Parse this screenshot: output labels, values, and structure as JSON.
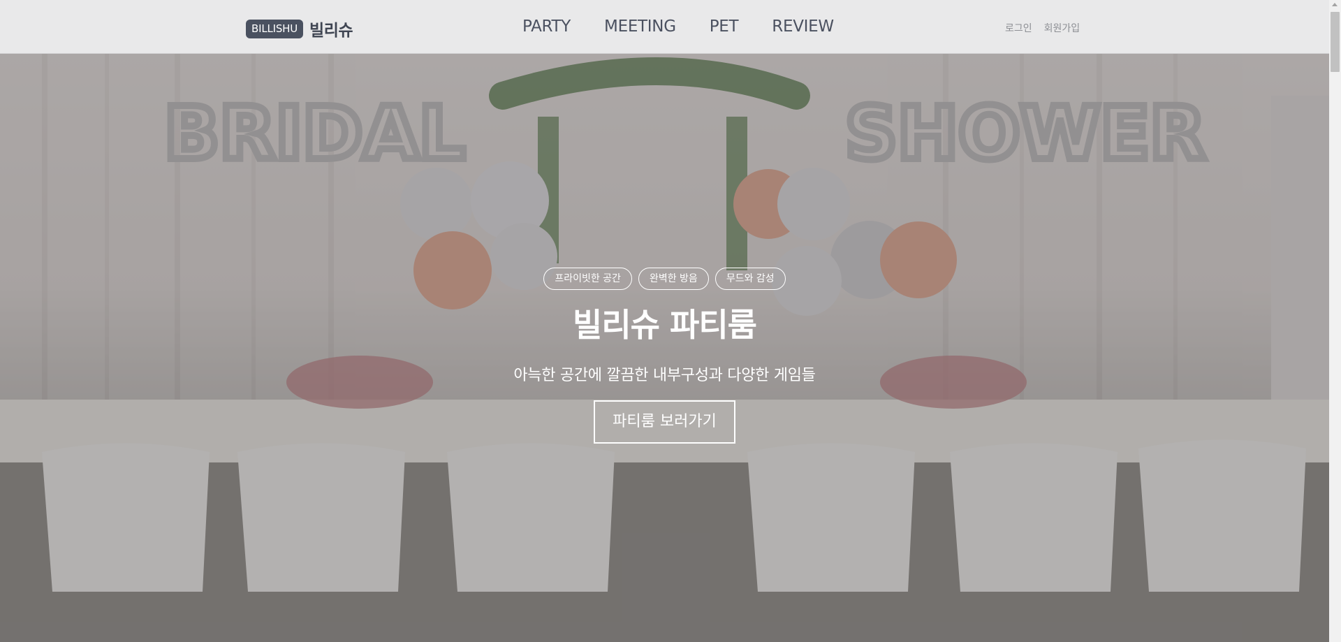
{
  "header": {
    "logo_badge": "BILLISHU",
    "logo_text": "빌리슈",
    "nav": [
      "PARTY",
      "MEETING",
      "PET",
      "REVIEW"
    ],
    "auth": {
      "login": "로그인",
      "signup": "회원가입"
    }
  },
  "hero": {
    "tags": [
      "프라이빗한 공간",
      "완벽한 방음",
      "무드와 감성"
    ],
    "title": "빌리슈 파티룸",
    "subtitle": "아늑한 공간에 깔끔한 내부구성과 다양한 게임들",
    "button": "파티룸 보러가기",
    "background_image": "bridal-shower-party-room-photo"
  },
  "colors": {
    "header_bg": "#e9e9ea",
    "logo_badge_bg": "#4a5160",
    "nav_text": "#4b5160",
    "auth_text": "#8d8f94",
    "hero_text": "#ffffff"
  }
}
